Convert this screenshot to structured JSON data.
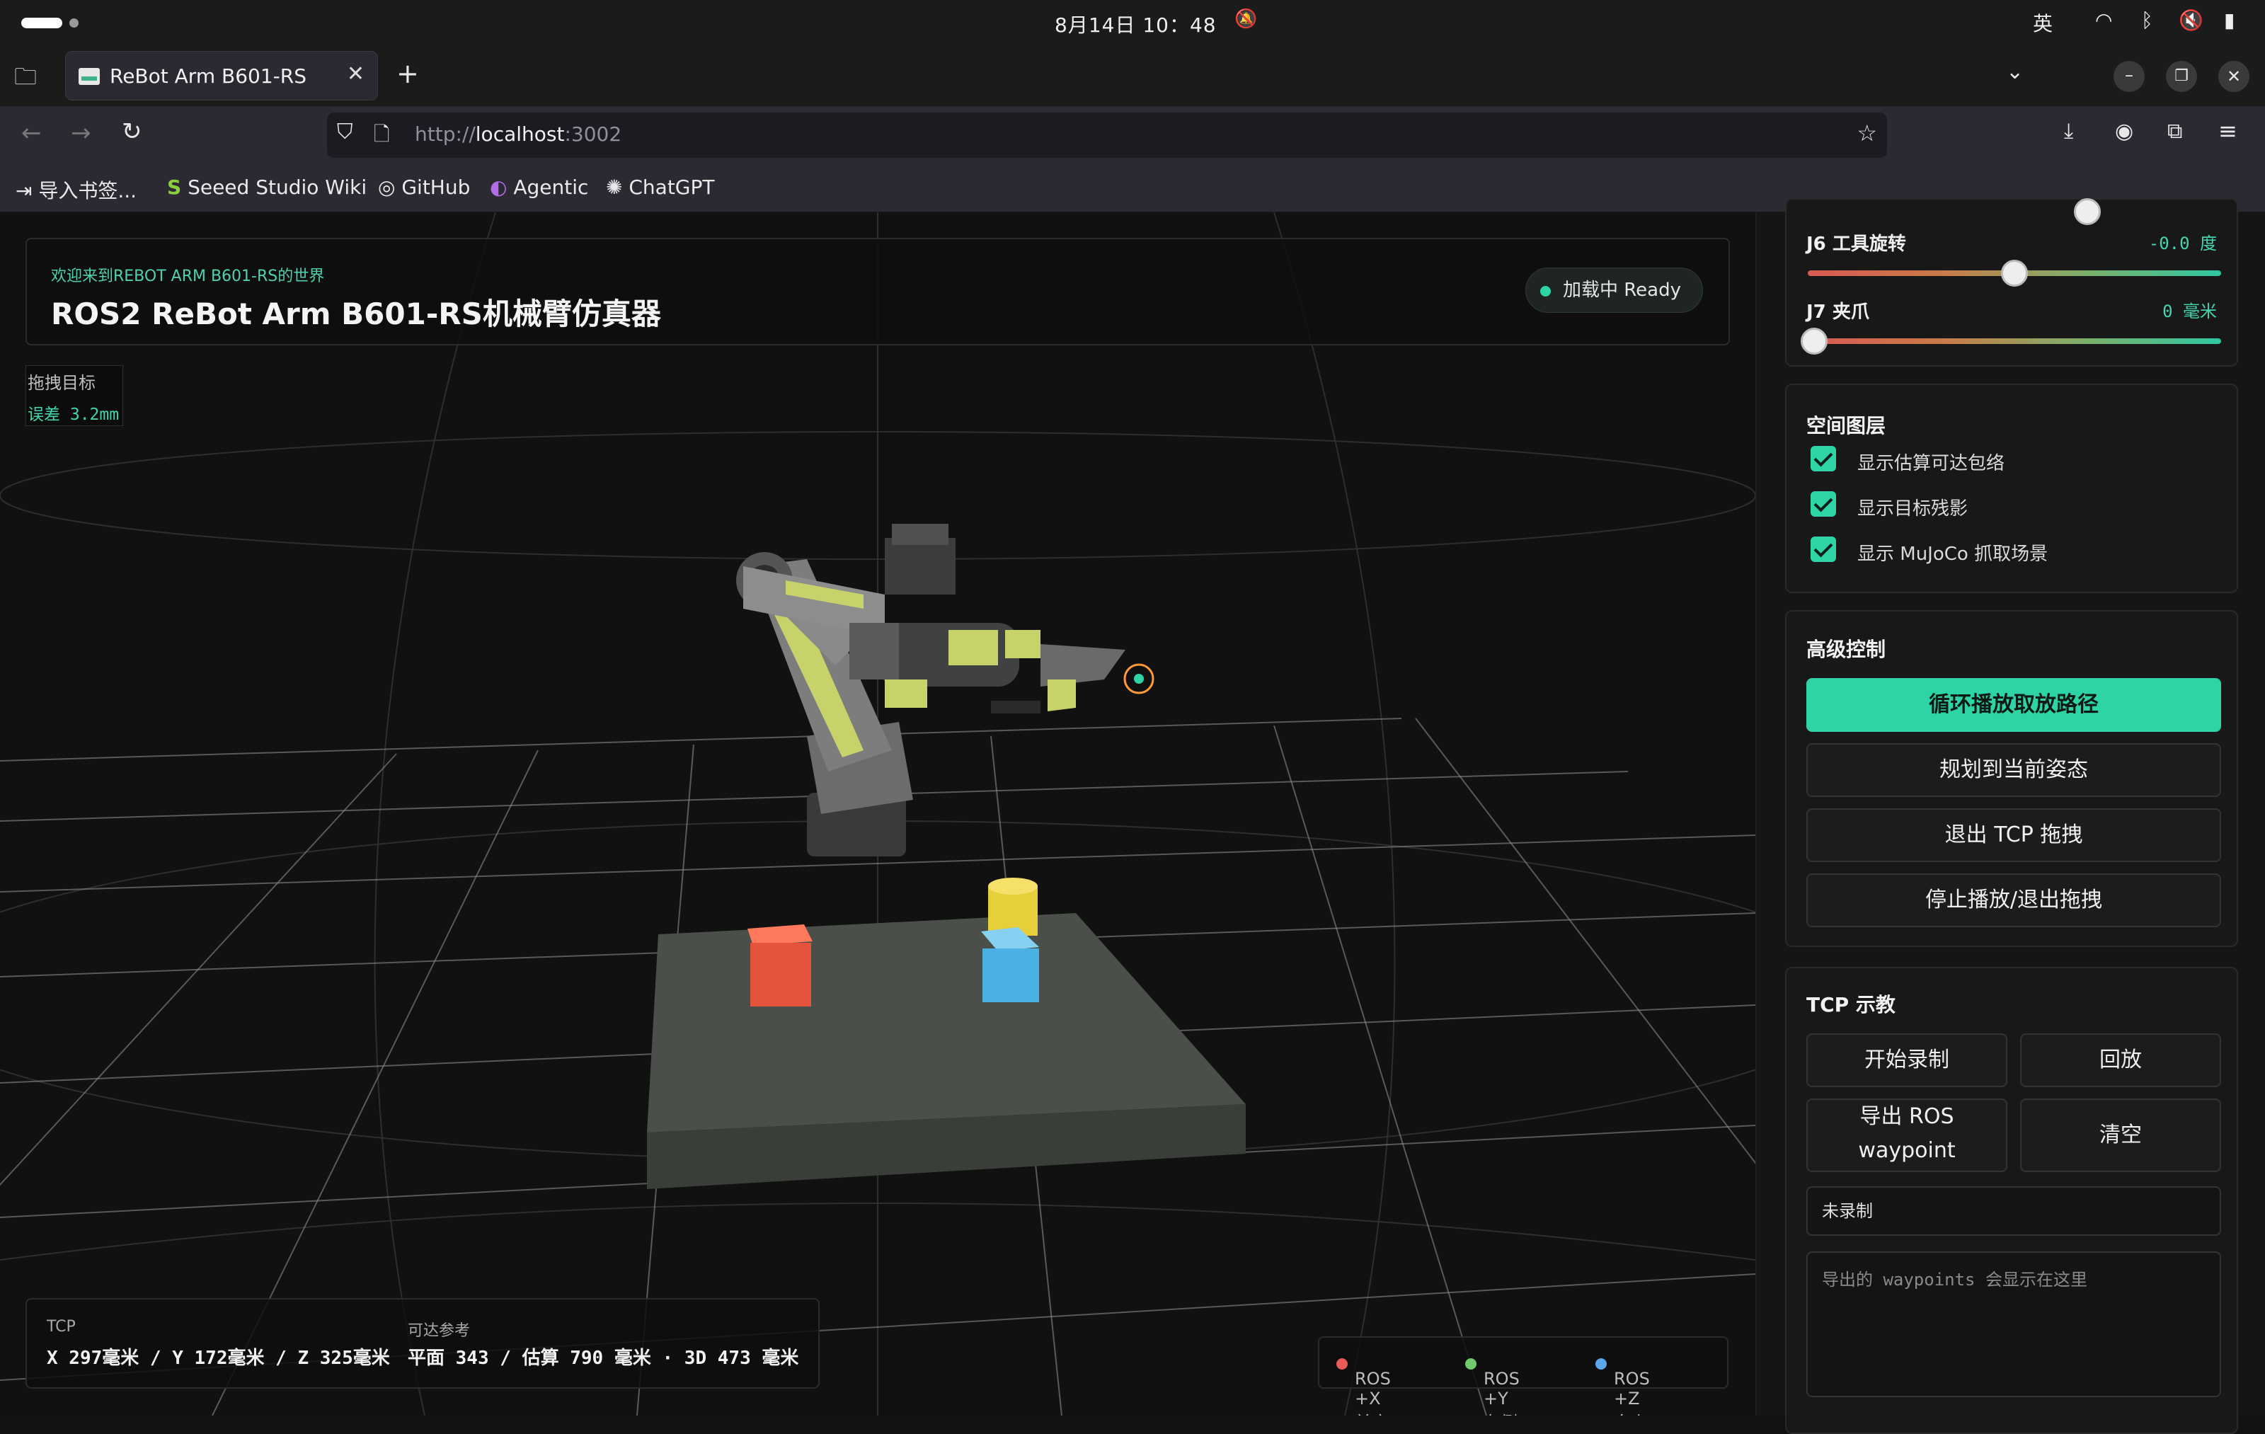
{
  "os": {
    "clock": "8月14日 10：48",
    "input_method": "英"
  },
  "browser": {
    "tab_title": "ReBot Arm B601-RS",
    "url_scheme": "http://",
    "url_host": "localhost",
    "url_port": ":3002",
    "bookmarks": [
      "导入书签...",
      "Seeed Studio Wiki",
      "GitHub",
      "Agentic",
      "ChatGPT"
    ]
  },
  "app": {
    "welcome": "欢迎来到REBOT ARM B601-RS的世界",
    "title": "ROS2 ReBot Arm B601-RS机械臂仿真器",
    "status": "加载中  Ready",
    "drag_label": "拖拽目标",
    "drag_error": "误差 3.2mm",
    "tcp_label": "TCP",
    "tcp_value": "X 297毫米 / Y 172毫米 / Z 325毫米",
    "reach_label": "可达参考",
    "reach_value": "平面 343 / 估算 790 毫米 · 3D 473 毫米",
    "legend": [
      "ROS +X 前方",
      "ROS +Y 左侧",
      "ROS +Z 向上"
    ],
    "legend_colors": [
      "#e85b57",
      "#72c96b",
      "#5aa7ea"
    ]
  },
  "panel": {
    "j6_label": "J6 工具旋转",
    "j6_value": "-0.0 度",
    "j6_fraction": 0.5,
    "j7_label": "J7 夹爪",
    "j7_value": "0 毫米",
    "j7_fraction": 0,
    "layers_title": "空间图层",
    "layers": [
      "显示估算可达包络",
      "显示目标残影",
      "显示 MuJoCo 抓取场景"
    ],
    "advanced_title": "高级控制",
    "btn_loop": "循环播放取放路径",
    "btn_plan": "规划到当前姿态",
    "btn_exit_tcp": "退出 TCP 拖拽",
    "btn_stop": "停止播放/退出拖拽",
    "teach_title": "TCP 示教",
    "btn_record": "开始录制",
    "btn_replay": "回放",
    "btn_export_1": "导出 ROS",
    "btn_export_2": "waypoint",
    "btn_clear": "清空",
    "record_status": "未录制",
    "waypoints_placeholder": "导出的 waypoints 会显示在这里"
  }
}
